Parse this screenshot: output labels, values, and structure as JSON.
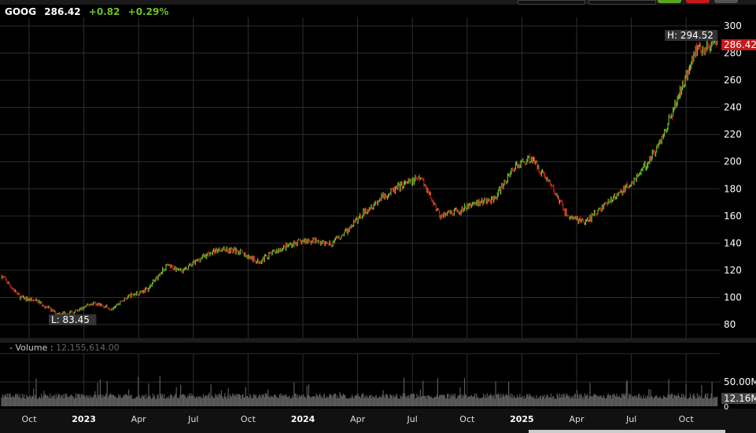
{
  "header": {
    "symbol": "GOOG",
    "price": "286.42",
    "change": "+0.82",
    "change_pct": "+0.29%"
  },
  "colors": {
    "up": "#6cc22a",
    "down": "#d11f1f",
    "grid": "#2e2e2e",
    "volume": "#5a5a5a"
  },
  "volume_pane": {
    "label": "- Volume :",
    "value": "12,155,614.00"
  },
  "chart_data": {
    "type": "candlestick",
    "title": "GOOG",
    "y_ticks": [
      300,
      280,
      260,
      240,
      220,
      200,
      180,
      160,
      140,
      120,
      100,
      80
    ],
    "ylim": [
      72,
      306
    ],
    "x_ticks": [
      {
        "label": "Oct",
        "month": 2,
        "year": false
      },
      {
        "label": "2023",
        "month": 5,
        "year": true
      },
      {
        "label": "Apr",
        "month": 8,
        "year": false
      },
      {
        "label": "Jul",
        "month": 11,
        "year": false
      },
      {
        "label": "Oct",
        "month": 14,
        "year": false
      },
      {
        "label": "2024",
        "month": 17,
        "year": true
      },
      {
        "label": "Apr",
        "month": 20,
        "year": false
      },
      {
        "label": "Jul",
        "month": 23,
        "year": false
      },
      {
        "label": "Oct",
        "month": 26,
        "year": false
      },
      {
        "label": "2025",
        "month": 29,
        "year": true
      },
      {
        "label": "Apr",
        "month": 32,
        "year": false
      },
      {
        "label": "Jul",
        "month": 35,
        "year": false
      },
      {
        "label": "Oct",
        "month": 38,
        "year": false
      }
    ],
    "approx_monthly_close": [
      {
        "m": "2022-08",
        "v": 116
      },
      {
        "m": "2022-09",
        "v": 100
      },
      {
        "m": "2022-10",
        "v": 97
      },
      {
        "m": "2022-11",
        "v": 88
      },
      {
        "m": "2022-12",
        "v": 89
      },
      {
        "m": "2023-01",
        "v": 96
      },
      {
        "m": "2023-02",
        "v": 92
      },
      {
        "m": "2023-03",
        "v": 101
      },
      {
        "m": "2023-04",
        "v": 106
      },
      {
        "m": "2023-05",
        "v": 123
      },
      {
        "m": "2023-06",
        "v": 120
      },
      {
        "m": "2023-07",
        "v": 130
      },
      {
        "m": "2023-08",
        "v": 136
      },
      {
        "m": "2023-09",
        "v": 134
      },
      {
        "m": "2023-10",
        "v": 126
      },
      {
        "m": "2023-11",
        "v": 134
      },
      {
        "m": "2023-12",
        "v": 140
      },
      {
        "m": "2024-01",
        "v": 142
      },
      {
        "m": "2024-02",
        "v": 139
      },
      {
        "m": "2024-03",
        "v": 150
      },
      {
        "m": "2024-04",
        "v": 165
      },
      {
        "m": "2024-05",
        "v": 175
      },
      {
        "m": "2024-06",
        "v": 183
      },
      {
        "m": "2024-07",
        "v": 188
      },
      {
        "m": "2024-08",
        "v": 160
      },
      {
        "m": "2024-09",
        "v": 163
      },
      {
        "m": "2024-10",
        "v": 170
      },
      {
        "m": "2024-11",
        "v": 172
      },
      {
        "m": "2024-12",
        "v": 195
      },
      {
        "m": "2025-01",
        "v": 203
      },
      {
        "m": "2025-02",
        "v": 185
      },
      {
        "m": "2025-03",
        "v": 160
      },
      {
        "m": "2025-04",
        "v": 155
      },
      {
        "m": "2025-05",
        "v": 168
      },
      {
        "m": "2025-06",
        "v": 178
      },
      {
        "m": "2025-07",
        "v": 192
      },
      {
        "m": "2025-08",
        "v": 212
      },
      {
        "m": "2025-09",
        "v": 245
      },
      {
        "m": "2025-10",
        "v": 282
      },
      {
        "m": "2025-11",
        "v": 286
      }
    ],
    "high_label": "H: 294.52",
    "low_label": "L: 83.45",
    "last_price_label": "286.42",
    "volume_ticks": [
      "50.00M",
      "0"
    ],
    "volume_last_label": "12.16M"
  }
}
